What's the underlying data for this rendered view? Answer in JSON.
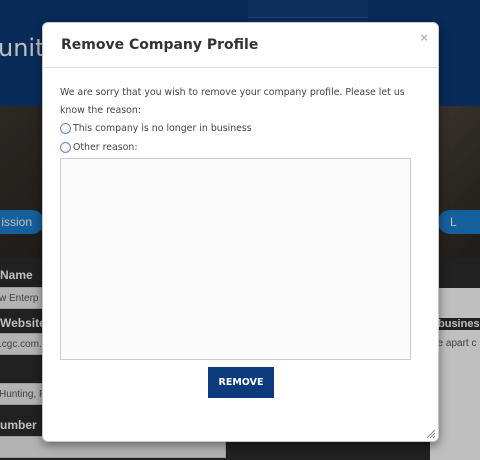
{
  "background": {
    "title_fragment": "unity",
    "left_button": "ission",
    "right_button": "L",
    "labels": {
      "name": "Name",
      "website": "Website",
      "number": "umber"
    },
    "fields": {
      "name_value": "w Enterp",
      "website_value": ".cgc.com.",
      "address_value": "Hunting, F"
    },
    "right_panel": {
      "label": "business",
      "text": "be apart c"
    },
    "colors": {
      "header": "#0b3a78",
      "pill": "#1d7fcf"
    }
  },
  "modal": {
    "title": "Remove Company Profile",
    "close_glyph": "×",
    "message": "We are sorry that you wish to remove your company profile. Please let us know the reason:",
    "options": [
      {
        "label": "This company is no longer in business",
        "selected": false
      },
      {
        "label": "Other reason:",
        "selected": false
      }
    ],
    "reason_text": "",
    "remove_label": "REMOVE",
    "colors": {
      "button": "#0c3b7d"
    }
  }
}
